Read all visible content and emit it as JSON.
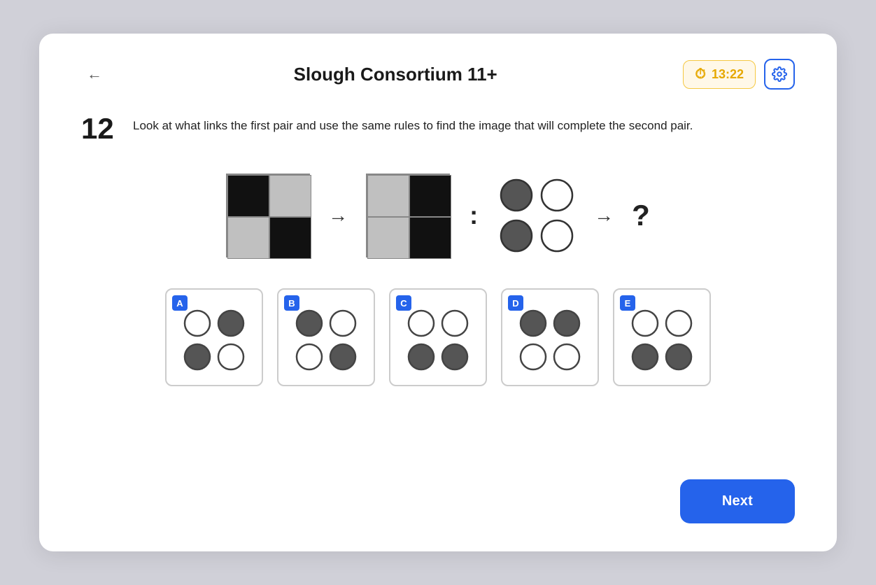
{
  "header": {
    "title": "Slough Consortium 11+",
    "back_label": "←",
    "timer": "13:22",
    "settings_icon": "⚙"
  },
  "question": {
    "number": "12",
    "text": "Look at what links the first pair and use the same rules to find the image that will complete the second pair."
  },
  "options": [
    {
      "label": "A"
    },
    {
      "label": "B"
    },
    {
      "label": "C"
    },
    {
      "label": "D"
    },
    {
      "label": "E"
    }
  ],
  "next_button": "Next"
}
